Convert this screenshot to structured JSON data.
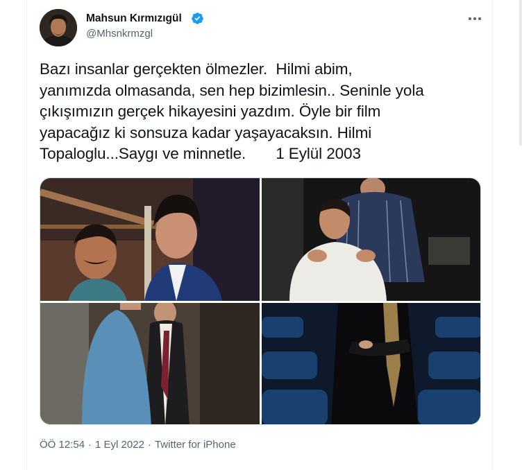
{
  "tweet": {
    "author": {
      "display_name": "Mahsun Kırmızıgül",
      "handle": "@Mhsnkrmzgl",
      "verified": true,
      "verified_icon": "verified-badge-icon",
      "accent_color": "#1d9bf0"
    },
    "text": "Bazı insanlar gerçekten ölmezler.  Hilmi abim,\nyanımızda olmasanda, sen hep bizimlesin.. Seninle yola\nçıkışımızın gerçek hikayesini yazdım. Öyle bir film\nyapacağız ki sonsuza kadar yaşayacaksın. Hilmi\nTopaloglu...Saygı ve minnetle.       1 Eylül 2003",
    "media": {
      "count": 4,
      "photos": [
        {
          "name": "photo-two-men-smiling"
        },
        {
          "name": "photo-man-in-white-sweater"
        },
        {
          "name": "photo-two-men-standing"
        },
        {
          "name": "photo-man-in-theater-seats"
        }
      ]
    },
    "meta": {
      "time": "ÖÖ 12:54",
      "date": "1 Eyl 2022",
      "source": "Twitter for iPhone",
      "separator": "·"
    }
  },
  "colors": {
    "text": "#0f1419",
    "secondary_text": "#536471",
    "border": "#cfd9de"
  }
}
